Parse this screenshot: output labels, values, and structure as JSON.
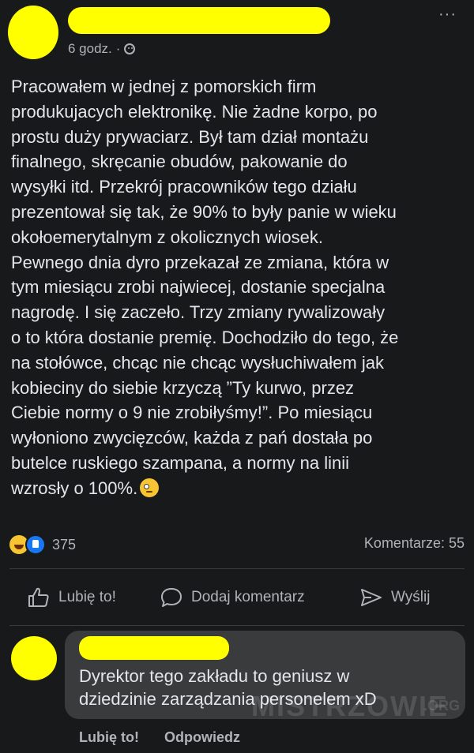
{
  "post": {
    "timestamp": "6 godz.",
    "separator": "·",
    "audience_icon": "globe-icon",
    "more_icon": "more-icon",
    "more_label": "···",
    "text": "Pracowałem w jednej z pomorskich firm\nprodukujacych elektronikę. Nie żadne korpo, po\nprostu duży prywaciarz. Był tam dział montażu\nfinalnego, skręcanie obudów, pakowanie do\nwysyłki itd. Przekrój pracowników tego działu\nprezentował się tak, że 90% to były panie w wieku\nokołoemerytalnym z okolicznych wiosek.\nPewnego dnia dyro przekazał ze zmiana, która w\ntym miesiącu zrobi najwiecej, dostanie specjalna\nnagrodę. I się zaczeło. Trzy zmiany rywalizowały\no to która dostanie premię. Dochodziło do tego, że\nna stołówce, chcąc nie chcąc wysłuchiwałem jak\nkobieciny do siebie krzyczą ”Ty kurwo, przez\nCiebie normy o 9 nie zrobiłyśmy!”. Po miesiącu\nwyłoniono zwycięzców, każda z pań dostała po\nbutelce ruskiego szampana, a normy na linii\nwzrosły o 100%.",
    "end_emoji": "face-with-monocle-emoji"
  },
  "reactions": {
    "icons": [
      "haha-reaction-icon",
      "like-reaction-icon"
    ],
    "count": "375",
    "comments": "Komentarze: 55"
  },
  "actions": {
    "like": "Lubię to!",
    "comment": "Dodaj komentarz",
    "share": "Wyślij"
  },
  "comment": {
    "text": "Dyrektor tego zakładu to geniusz w\ndziedzinie zarządzania personelem xD",
    "like": "Lubię to!",
    "reply": "Odpowiedz"
  },
  "watermark": {
    "brand": "MISTRZOWIE",
    "suffix": ".ORG"
  },
  "colors": {
    "background": "#18191a",
    "redaction": "#ffff00",
    "bubble": "#3a3b3c",
    "secondary_text": "#b0b3b8"
  }
}
